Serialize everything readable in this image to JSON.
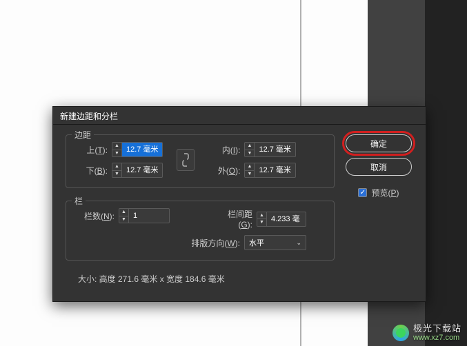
{
  "dialog": {
    "title": "新建边距和分栏",
    "margins": {
      "group_title": "边距",
      "top_label_pre": "上(",
      "top_label_key": "T",
      "top_label_post": "):",
      "top_value": "12.7 毫米",
      "bottom_label_pre": "下(",
      "bottom_label_key": "B",
      "bottom_label_post": "):",
      "bottom_value": "12.7 毫米",
      "inner_label_pre": "内(",
      "inner_label_key": "I",
      "inner_label_post": "):",
      "inner_value": "12.7 毫米",
      "outer_label_pre": "外(",
      "outer_label_key": "O",
      "outer_label_post": "):",
      "outer_value": "12.7 毫米"
    },
    "columns": {
      "group_title": "栏",
      "count_label_pre": "栏数(",
      "count_label_key": "N",
      "count_label_post": "):",
      "count_value": "1",
      "gutter_label_pre": "栏间距(",
      "gutter_label_key": "G",
      "gutter_label_post": "):",
      "gutter_value": "4.233 毫",
      "direction_label_pre": "排版方向(",
      "direction_label_key": "W",
      "direction_label_post": "):",
      "direction_value": "水平"
    },
    "size_line": "大小: 高度 271.6 毫米 x 宽度 184.6 毫米",
    "buttons": {
      "ok": "确定",
      "cancel": "取消"
    },
    "preview_label_pre": "预览(",
    "preview_label_key": "P",
    "preview_label_post": ")",
    "preview_checked": true
  },
  "watermark": {
    "name": "极光下载站",
    "url": "www.xz7.com"
  }
}
